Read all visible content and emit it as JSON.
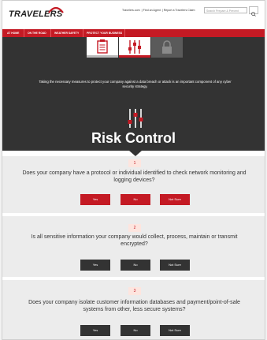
{
  "header": {
    "logo_text": "TRAVELERS",
    "top_links": [
      "Travelers.com",
      "Find an Agent",
      "Report a Travelers Claim"
    ],
    "search_placeholder": "Search Prepare & Prevent"
  },
  "nav": {
    "items": [
      "AT HOME",
      "ON THE ROAD",
      "WEATHER SAFETY",
      "PROTECT YOUR BUSINESS"
    ]
  },
  "hero": {
    "tab_icons": [
      "clipboard-icon",
      "sliders-icon",
      "lock-icon"
    ],
    "description": "Taking the necessary measures to protect your company against a data breach or attack is an important component of any cyber security strategy.",
    "title": "Risk Control",
    "icon": "sliders-icon"
  },
  "questions": [
    {
      "number": "1",
      "text": "Does your company have a protocol or individual identified to check network monitoring and logging devices?",
      "answers": [
        "Yes",
        "No",
        "Not Sure"
      ],
      "button_color": "#c41a24"
    },
    {
      "number": "2",
      "text": "Is all sensitive information your company would collect, process, maintain or transmit encrypted?",
      "answers": [
        "Yes",
        "No",
        "Not Sure"
      ],
      "button_color": "#333333"
    },
    {
      "number": "3",
      "text": "Does your company isolate customer information databases and payment/point-of-sale systems from other, less secure systems?",
      "answers": [
        "Yes",
        "No",
        "Not Sure"
      ],
      "button_color": "#333333"
    }
  ],
  "colors": {
    "brand_red": "#c41a24",
    "hero_dark": "#333333",
    "question_bg": "#ececec"
  }
}
